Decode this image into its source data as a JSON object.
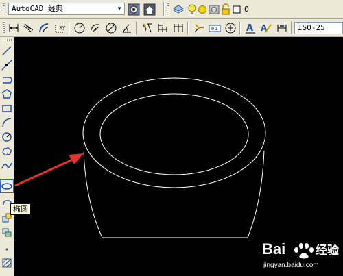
{
  "toolbar_top": {
    "workspace_combo": "AutoCAD 经典",
    "layer_value": "0",
    "icons": [
      "workspace-settings-icon",
      "workspace-home-icon",
      "layer-manager-icon",
      "light-bulb-icon",
      "sun-icon",
      "lock-icon",
      "color-swatch-icon"
    ]
  },
  "toolbar_dim": {
    "dimstyle_combo": "ISO-25",
    "icons": [
      "linear-dim-icon",
      "aligned-dim-icon",
      "arc-length-icon",
      "ordinate-dim-icon",
      "radius-dim-icon",
      "jogged-dim-icon",
      "diameter-dim-icon",
      "angular-dim-icon",
      "quick-dim-icon",
      "baseline-dim-icon",
      "continue-dim-icon",
      "quick-leader-icon",
      "tolerance-icon",
      "center-mark-icon",
      "dim-edit-icon",
      "dim-text-edit-icon",
      "dim-update-icon"
    ]
  },
  "draw_toolbar": {
    "tools": [
      "line-tool",
      "construction-line-tool",
      "polyline-tool",
      "polygon-tool",
      "rectangle-tool",
      "arc-tool",
      "circle-tool",
      "revision-cloud-tool",
      "spline-tool",
      "ellipse-tool",
      "ellipse-arc-tool",
      "insert-block-tool",
      "make-block-tool",
      "point-tool",
      "hatch-tool"
    ],
    "selected": "ellipse-tool",
    "tooltip": "椭圆"
  },
  "canvas": {
    "background": "#000000",
    "stroke": "#ffffff",
    "arrow_color": "#e8312a"
  },
  "watermark": {
    "brand": "Bai 经验",
    "url": "jingyan.baidu.com"
  }
}
